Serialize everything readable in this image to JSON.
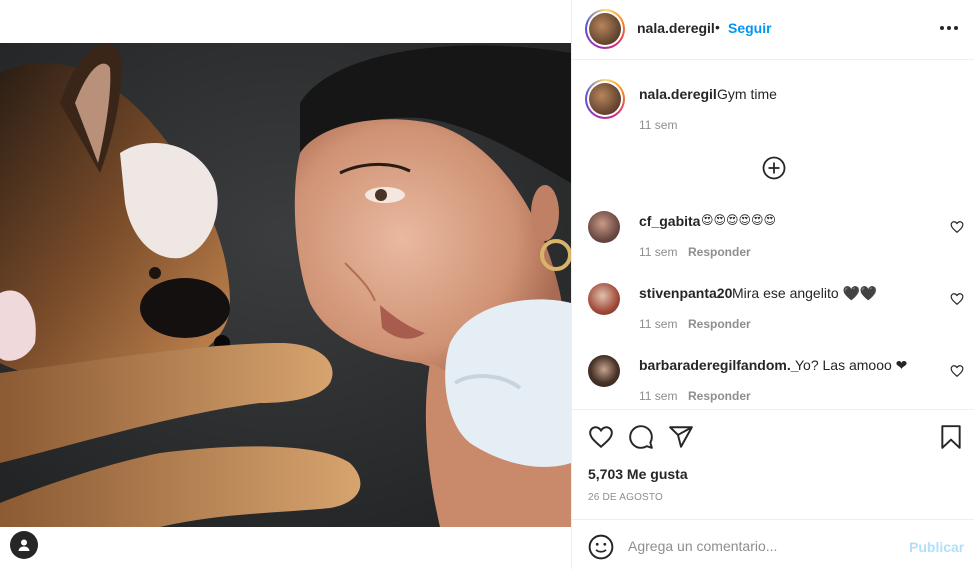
{
  "post": {
    "username": "nala.deregil",
    "follow_label": "Seguir",
    "separator": "•",
    "caption": "Gym time",
    "caption_time": "11 sem",
    "likes": "5,703 Me gusta",
    "date": "26 DE AGOSTO"
  },
  "comments": [
    {
      "username": "cf_gabita",
      "text": "😍😍😍😍😍😍",
      "time": "11 sem",
      "reply": "Responder"
    },
    {
      "username": "stivenpanta20",
      "text": "Mira ese angelito 🖤🖤",
      "time": "11 sem",
      "reply": "Responder"
    },
    {
      "username": "barbaraderegilfandom._",
      "text": "Yo? Las amooo ❤",
      "time": "11 sem",
      "reply": "Responder"
    }
  ],
  "composer": {
    "placeholder": "Agrega un comentario...",
    "publish_label": "Publicar"
  },
  "icons": {
    "more": "more-options-icon",
    "load_more": "plus-circle-icon",
    "like": "heart-icon",
    "comment": "comment-icon",
    "share": "paper-plane-icon",
    "save": "bookmark-icon",
    "emoji": "smiley-icon",
    "tags": "user-tag-icon"
  },
  "colors": {
    "link": "#0095f6",
    "publish_disabled": "#b2dffc",
    "secondary_text": "#8e8e8e",
    "heart_red": "#c00a0a"
  }
}
